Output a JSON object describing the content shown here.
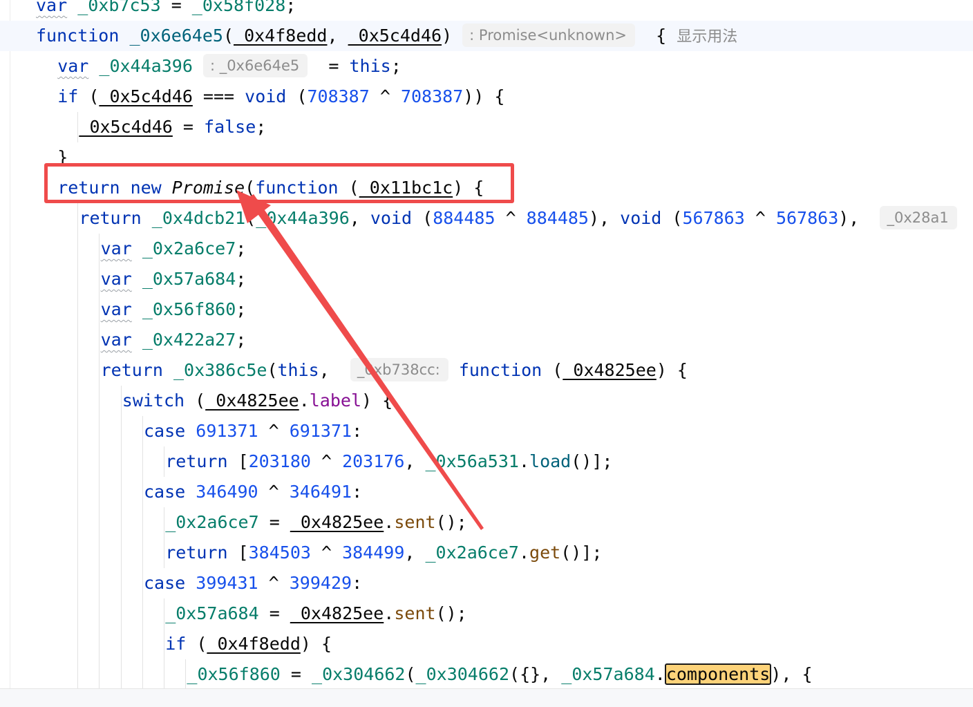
{
  "editor": {
    "lines": [
      {
        "tokens": [
          {
            "t": "var",
            "c": "kw squig"
          },
          {
            "t": " "
          },
          {
            "t": "_0xb7c53",
            "c": "var"
          },
          {
            "t": " = "
          },
          {
            "t": "_0x58f028",
            "c": "var"
          },
          {
            "t": ";"
          }
        ]
      },
      {
        "tokens": [
          {
            "t": "function",
            "c": "kw"
          },
          {
            "t": " "
          },
          {
            "t": "_0x6e64e5",
            "c": "fn"
          },
          {
            "t": "("
          },
          {
            "t": "_0x4f8edd",
            "c": "param"
          },
          {
            "t": ", "
          },
          {
            "t": "_0x5c4d46",
            "c": "param"
          },
          {
            "t": ") "
          },
          {
            "t": ": Promise<unknown>",
            "c": "hint"
          },
          {
            "t": "  { "
          },
          {
            "t": "显示用法",
            "c": "usage"
          }
        ]
      },
      {
        "tokens": [
          {
            "t": "var",
            "c": "kw squig"
          },
          {
            "t": " "
          },
          {
            "t": "_0x44a396",
            "c": "var"
          },
          {
            "t": " "
          },
          {
            "t": ": _0x6e64e5",
            "c": "hint"
          },
          {
            "t": "  = "
          },
          {
            "t": "this",
            "c": "kw"
          },
          {
            "t": ";"
          }
        ]
      },
      {
        "tokens": [
          {
            "t": "if",
            "c": "kw"
          },
          {
            "t": " ("
          },
          {
            "t": "_0x5c4d46",
            "c": "param"
          },
          {
            "t": " === "
          },
          {
            "t": "void",
            "c": "kw"
          },
          {
            "t": " ("
          },
          {
            "t": "708387",
            "c": "num"
          },
          {
            "t": " ^ "
          },
          {
            "t": "708387",
            "c": "num"
          },
          {
            "t": ")) {"
          }
        ]
      },
      {
        "tokens": [
          {
            "t": "_0x5c4d46",
            "c": "param"
          },
          {
            "t": " = "
          },
          {
            "t": "false",
            "c": "kw"
          },
          {
            "t": ";"
          }
        ]
      },
      {
        "tokens": [
          {
            "t": "}"
          }
        ]
      },
      {
        "tokens": [
          {
            "t": "return",
            "c": "kw"
          },
          {
            "t": " "
          },
          {
            "t": "new",
            "c": "kw"
          },
          {
            "t": " "
          },
          {
            "t": "Promise",
            "c": "ital"
          },
          {
            "t": "("
          },
          {
            "t": "function",
            "c": "kw"
          },
          {
            "t": " ("
          },
          {
            "t": "_0x11bc1c",
            "c": "param"
          },
          {
            "t": ") {"
          }
        ]
      },
      {
        "tokens": [
          {
            "t": "return",
            "c": "kw"
          },
          {
            "t": " "
          },
          {
            "t": "_0x4dcb21",
            "c": "var"
          },
          {
            "t": "("
          },
          {
            "t": "_0x44a396",
            "c": "var"
          },
          {
            "t": ", "
          },
          {
            "t": "void",
            "c": "kw"
          },
          {
            "t": " ("
          },
          {
            "t": "884485",
            "c": "num"
          },
          {
            "t": " ^ "
          },
          {
            "t": "884485",
            "c": "num"
          },
          {
            "t": "), "
          },
          {
            "t": "void",
            "c": "kw"
          },
          {
            "t": " ("
          },
          {
            "t": "567863",
            "c": "num"
          },
          {
            "t": " ^ "
          },
          {
            "t": "567863",
            "c": "num"
          },
          {
            "t": "),  "
          },
          {
            "t": "_0x28a1",
            "c": "hint"
          }
        ]
      },
      {
        "tokens": [
          {
            "t": "var",
            "c": "kw squig"
          },
          {
            "t": " "
          },
          {
            "t": "_0x2a6ce7",
            "c": "var"
          },
          {
            "t": ";"
          }
        ]
      },
      {
        "tokens": [
          {
            "t": "var",
            "c": "kw squig"
          },
          {
            "t": " "
          },
          {
            "t": "_0x57a684",
            "c": "var"
          },
          {
            "t": ";"
          }
        ]
      },
      {
        "tokens": [
          {
            "t": "var",
            "c": "kw squig"
          },
          {
            "t": " "
          },
          {
            "t": "_0x56f860",
            "c": "var"
          },
          {
            "t": ";"
          }
        ]
      },
      {
        "tokens": [
          {
            "t": "var",
            "c": "kw squig"
          },
          {
            "t": " "
          },
          {
            "t": "_0x422a27",
            "c": "var"
          },
          {
            "t": ";"
          }
        ]
      },
      {
        "tokens": [
          {
            "t": "return",
            "c": "kw"
          },
          {
            "t": " "
          },
          {
            "t": "_0x386c5e",
            "c": "var"
          },
          {
            "t": "("
          },
          {
            "t": "this",
            "c": "kw"
          },
          {
            "t": ",  "
          },
          {
            "t": "_0xb738cc:",
            "c": "hint"
          },
          {
            "t": " "
          },
          {
            "t": "function",
            "c": "kw"
          },
          {
            "t": " ("
          },
          {
            "t": "_0x4825ee",
            "c": "param"
          },
          {
            "t": ") {"
          }
        ]
      },
      {
        "tokens": [
          {
            "t": "switch",
            "c": "kw"
          },
          {
            "t": " ("
          },
          {
            "t": "_0x4825ee",
            "c": "param"
          },
          {
            "t": "."
          },
          {
            "t": "label",
            "c": "prop"
          },
          {
            "t": ") {"
          }
        ]
      },
      {
        "tokens": [
          {
            "t": "case",
            "c": "kw"
          },
          {
            "t": " "
          },
          {
            "t": "691371",
            "c": "num"
          },
          {
            "t": " ^ "
          },
          {
            "t": "691371",
            "c": "num"
          },
          {
            "t": ":"
          }
        ]
      },
      {
        "tokens": [
          {
            "t": "return",
            "c": "kw"
          },
          {
            "t": " ["
          },
          {
            "t": "203180",
            "c": "num"
          },
          {
            "t": " ^ "
          },
          {
            "t": "203176",
            "c": "num"
          },
          {
            "t": ", "
          },
          {
            "t": "_0x56a531",
            "c": "var"
          },
          {
            "t": "."
          },
          {
            "t": "load",
            "c": "fn"
          },
          {
            "t": "()];"
          }
        ]
      },
      {
        "tokens": [
          {
            "t": "case",
            "c": "kw"
          },
          {
            "t": " "
          },
          {
            "t": "346490",
            "c": "num"
          },
          {
            "t": " ^ "
          },
          {
            "t": "346491",
            "c": "num"
          },
          {
            "t": ":"
          }
        ]
      },
      {
        "tokens": [
          {
            "t": "_0x2a6ce7",
            "c": "var"
          },
          {
            "t": " = "
          },
          {
            "t": "_0x4825ee",
            "c": "param"
          },
          {
            "t": "."
          },
          {
            "t": "sent",
            "c": "mth"
          },
          {
            "t": "();"
          }
        ]
      },
      {
        "tokens": [
          {
            "t": "return",
            "c": "kw"
          },
          {
            "t": " ["
          },
          {
            "t": "384503",
            "c": "num"
          },
          {
            "t": " ^ "
          },
          {
            "t": "384499",
            "c": "num"
          },
          {
            "t": ", "
          },
          {
            "t": "_0x2a6ce7",
            "c": "var"
          },
          {
            "t": "."
          },
          {
            "t": "get",
            "c": "mth"
          },
          {
            "t": "()];"
          }
        ]
      },
      {
        "tokens": [
          {
            "t": "case",
            "c": "kw"
          },
          {
            "t": " "
          },
          {
            "t": "399431",
            "c": "num"
          },
          {
            "t": " ^ "
          },
          {
            "t": "399429",
            "c": "num"
          },
          {
            "t": ":"
          }
        ]
      },
      {
        "tokens": [
          {
            "t": "_0x57a684",
            "c": "var"
          },
          {
            "t": " = "
          },
          {
            "t": "_0x4825ee",
            "c": "param"
          },
          {
            "t": "."
          },
          {
            "t": "sent",
            "c": "mth"
          },
          {
            "t": "();"
          }
        ]
      },
      {
        "tokens": [
          {
            "t": "if",
            "c": "kw"
          },
          {
            "t": " ("
          },
          {
            "t": "_0x4f8edd",
            "c": "param"
          },
          {
            "t": ") {"
          }
        ]
      },
      {
        "tokens": [
          {
            "t": "_0x56f860",
            "c": "var"
          },
          {
            "t": " = "
          },
          {
            "t": "_0x304662",
            "c": "var"
          },
          {
            "t": "("
          },
          {
            "t": "_0x304662",
            "c": "var"
          },
          {
            "t": "({}, "
          },
          {
            "t": "_0x57a684",
            "c": "var"
          },
          {
            "t": "."
          },
          {
            "t": "components",
            "c": "hl"
          },
          {
            "t": "), {"
          }
        ]
      }
    ]
  }
}
